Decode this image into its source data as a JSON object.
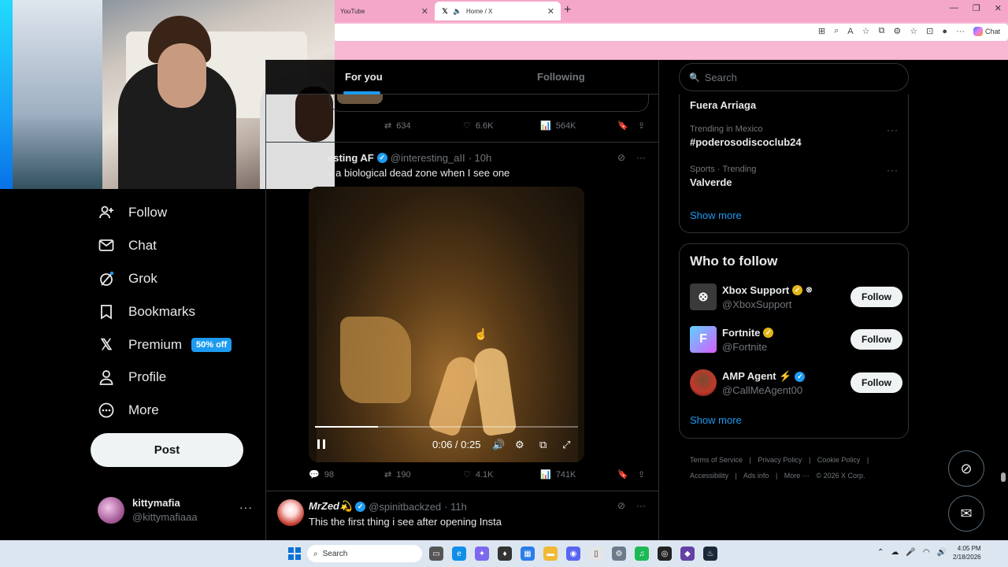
{
  "browser": {
    "tabs": [
      {
        "label": "YouTube",
        "active": false
      },
      {
        "label": "Home / X",
        "active": true
      }
    ],
    "address_icons": [
      "reader-icon",
      "zoom-icon",
      "read-aloud-icon",
      "favorite-star-icon",
      "split-screen-icon",
      "extensions-icon",
      "favorites-icon",
      "collections-icon",
      "profile-icon",
      "more-icon"
    ],
    "chat_label": "Chat"
  },
  "nav": {
    "items": [
      {
        "label": "Follow",
        "icon": "follow-icon"
      },
      {
        "label": "Chat",
        "icon": "chat-icon"
      },
      {
        "label": "Grok",
        "icon": "grok-icon"
      },
      {
        "label": "Bookmarks",
        "icon": "bookmark-icon"
      },
      {
        "label": "Premium",
        "icon": "x-logo-icon",
        "badge": "50% off"
      },
      {
        "label": "Profile",
        "icon": "profile-icon"
      },
      {
        "label": "More",
        "icon": "more-circle-icon"
      }
    ],
    "post_label": "Post",
    "account": {
      "name": "kittymafia",
      "handle": "@kittymafiaaa",
      "more": "···"
    }
  },
  "feed": {
    "tabs": [
      {
        "label": "For you"
      },
      {
        "label": "Following"
      }
    ],
    "prev_tweet_actions": {
      "reposts": "634",
      "likes": "6.6K",
      "views": "564K"
    },
    "tweet": {
      "author": "esting AF",
      "handle": "@interesting_aII",
      "time": "· 10h",
      "text": "v a biological dead zone when I see one",
      "video": {
        "time": "0:06 / 0:25",
        "progress": 0.24
      },
      "actions": {
        "replies": "98",
        "reposts": "190",
        "likes": "4.1K",
        "views": "741K"
      }
    },
    "next_tweet": {
      "author": "MrZed💫",
      "handle": "@spinitbackzed",
      "time": "· 11h",
      "text": "This the first thing i see after opening Insta"
    }
  },
  "right": {
    "search_placeholder": "Search",
    "trends": [
      {
        "category": "",
        "topic": "Fuera Arriaga"
      },
      {
        "category": "Trending in Mexico",
        "topic": "#poderosodiscoclub24"
      },
      {
        "category": "Sports · Trending",
        "topic": "Valverde"
      }
    ],
    "trends_show_more": "Show more",
    "who_to_follow": {
      "title": "Who to follow",
      "accounts": [
        {
          "name": "Xbox Support",
          "handle": "@XboxSupport",
          "follow": "Follow"
        },
        {
          "name": "Fortnite",
          "handle": "@Fortnite",
          "follow": "Follow"
        },
        {
          "name": "AMP Agent ⚡",
          "handle": "@CallMeAgent00",
          "follow": "Follow"
        }
      ],
      "show_more": "Show more"
    },
    "footer": [
      "Terms of Service",
      "|",
      "Privacy Policy",
      "|",
      "Cookie Policy",
      "|",
      "Accessibility",
      "|",
      "Ads info",
      "|",
      "More ···",
      "© 2026 X Corp."
    ]
  },
  "taskbar": {
    "search_label": "Search",
    "time": "4:05 PM",
    "date": "2/18/2026"
  }
}
